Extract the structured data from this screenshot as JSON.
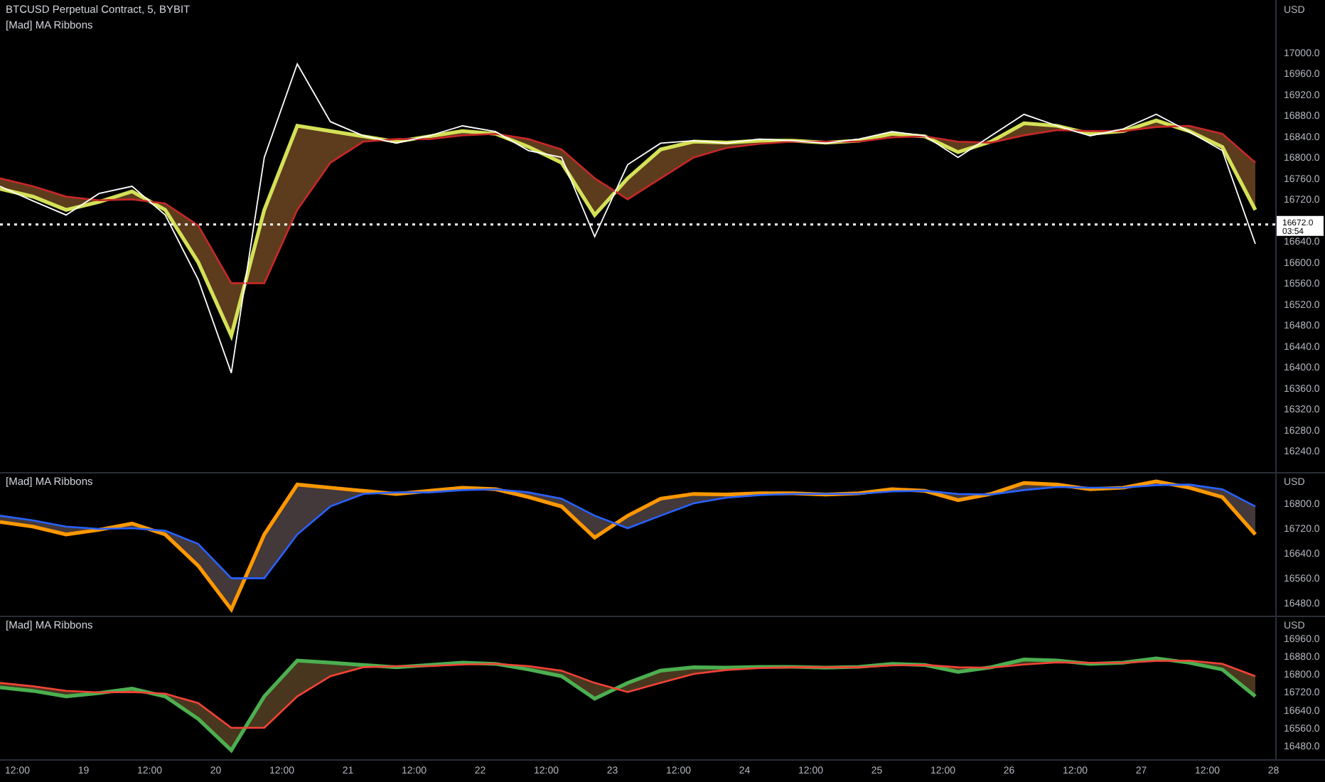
{
  "panes": [
    {
      "kind": "price",
      "legend": [
        "BTCUSD Perpetual Contract, 5, BYBIT",
        "[Mad] MA Ribbons"
      ],
      "axis_unit": "USD",
      "last_price": {
        "countdown": "03:54"
      },
      "chart_data": {
        "type": "line",
        "categories": [
          null,
          null,
          null,
          null,
          null,
          null,
          null,
          null,
          null,
          null,
          null,
          null,
          null,
          null,
          null,
          null,
          null,
          null,
          null,
          null,
          null,
          null,
          null,
          null,
          null,
          null,
          null,
          null,
          null,
          null,
          null,
          null,
          null,
          null,
          null,
          null,
          null,
          null,
          null
        ],
        "ylim": [
          16200,
          17100
        ],
        "yticks": [
          {
            "value": 17000,
            "label": "17000.0"
          },
          {
            "value": 16960,
            "label": "16960.0"
          },
          {
            "value": 16920,
            "label": "16920.0"
          },
          {
            "value": 16880,
            "label": "16880.0"
          },
          {
            "value": 16840,
            "label": "16840.0"
          },
          {
            "value": 16800,
            "label": "16800.0"
          },
          {
            "value": 16760,
            "label": "16760.0"
          },
          {
            "value": 16720,
            "label": "16720.0"
          },
          {
            "value": 16640,
            "label": "16640.0"
          },
          {
            "value": 16600,
            "label": "16600.0"
          },
          {
            "value": 16560,
            "label": "16560.0"
          },
          {
            "value": 16520,
            "label": "16520.0"
          },
          {
            "value": 16480,
            "label": "16480.0"
          },
          {
            "value": 16440,
            "label": "16440.0"
          },
          {
            "value": 16400,
            "label": "16400.0"
          },
          {
            "value": 16360,
            "label": "16360.0"
          },
          {
            "value": 16320,
            "label": "16320.0"
          },
          {
            "value": 16280,
            "label": "16280.0"
          },
          {
            "value": 16240,
            "label": "16240.0"
          }
        ],
        "series": [
          {
            "color": "#ffffff",
            "values": [
              16745,
              16717,
              16690,
              16731,
              16745,
              16690,
              16567,
              16389,
              16800,
              16978,
              16868,
              16841,
              16827,
              16841,
              16860,
              16849,
              16813,
              16800,
              16649,
              16786,
              16827,
              16832,
              16827,
              16835,
              16832,
              16827,
              16835,
              16849,
              16841,
              16800,
              16841,
              16882,
              16860,
              16841,
              16854,
              16882,
              16849,
              16813,
              16635
            ]
          },
          {
            "color": "#d4e157",
            "values": [
              16740,
              16725,
              16700,
              16715,
              16735,
              16700,
              16600,
              16460,
              16700,
              16860,
              16850,
              16840,
              16830,
              16840,
              16850,
              16845,
              16820,
              16790,
              16690,
              16760,
              16815,
              16830,
              16828,
              16832,
              16832,
              16828,
              16832,
              16845,
              16840,
              16810,
              16830,
              16865,
              16860,
              16845,
              16850,
              16870,
              16850,
              16820,
              16700
            ]
          },
          {
            "color": "#c62828",
            "values": [
              16760,
              16745,
              16725,
              16718,
              16720,
              16712,
              16670,
              16560,
              16560,
              16700,
              16790,
              16830,
              16835,
              16835,
              16842,
              16845,
              16835,
              16815,
              16760,
              16720,
              16760,
              16800,
              16818,
              16826,
              16830,
              16830,
              16830,
              16838,
              16840,
              16830,
              16828,
              16842,
              16852,
              16850,
              16850,
              16858,
              16860,
              16845,
              16790
            ]
          }
        ],
        "ref_lines": [
          {
            "axis": "y",
            "value": 16672,
            "label": "16672.0"
          }
        ]
      }
    },
    {
      "kind": "indicator",
      "legend": [
        "[Mad] MA Ribbons"
      ],
      "axis_unit": "USD",
      "chart_data": {
        "type": "line",
        "categories": [
          null,
          null,
          null,
          null,
          null,
          null,
          null,
          null,
          null,
          null,
          null,
          null,
          null,
          null,
          null,
          null,
          null,
          null,
          null,
          null,
          null,
          null,
          null,
          null,
          null,
          null,
          null,
          null,
          null,
          null,
          null,
          null,
          null,
          null,
          null,
          null,
          null,
          null,
          null
        ],
        "ylim": [
          16440,
          16900
        ],
        "yticks": [
          {
            "value": 16800,
            "label": "16800.0"
          },
          {
            "value": 16720,
            "label": "16720.0"
          },
          {
            "value": 16640,
            "label": "16640.0"
          },
          {
            "value": 16560,
            "label": "16560.0"
          },
          {
            "value": 16480,
            "label": "16480.0"
          }
        ],
        "series": [
          {
            "color": "#ff9800",
            "values": [
              16740,
              16725,
              16700,
              16715,
              16735,
              16700,
              16600,
              16460,
              16700,
              16860,
              16850,
              16840,
              16830,
              16840,
              16850,
              16845,
              16820,
              16790,
              16690,
              16760,
              16815,
              16830,
              16828,
              16832,
              16832,
              16828,
              16832,
              16845,
              16840,
              16810,
              16830,
              16865,
              16860,
              16845,
              16850,
              16870,
              16850,
              16820,
              16700
            ]
          },
          {
            "color": "#2962ff",
            "values": [
              16760,
              16745,
              16725,
              16718,
              16720,
              16712,
              16670,
              16560,
              16560,
              16700,
              16790,
              16830,
              16835,
              16835,
              16842,
              16845,
              16835,
              16815,
              16760,
              16720,
              16760,
              16800,
              16818,
              16826,
              16830,
              16830,
              16830,
              16838,
              16840,
              16830,
              16828,
              16842,
              16852,
              16850,
              16850,
              16858,
              16860,
              16845,
              16790
            ]
          }
        ]
      }
    },
    {
      "kind": "indicator",
      "legend": [
        "[Mad] MA Ribbons"
      ],
      "axis_unit": "USD",
      "chart_data": {
        "type": "line",
        "categories": [
          null,
          null,
          null,
          null,
          null,
          null,
          null,
          null,
          null,
          null,
          null,
          null,
          null,
          null,
          null,
          null,
          null,
          null,
          null,
          null,
          null,
          null,
          null,
          null,
          null,
          null,
          null,
          null,
          null,
          null,
          null,
          null,
          null,
          null,
          null,
          null,
          null,
          null,
          null
        ],
        "ylim": [
          16420,
          17060
        ],
        "yticks": [
          {
            "value": 16960,
            "label": "16960.0"
          },
          {
            "value": 16880,
            "label": "16880.0"
          },
          {
            "value": 16800,
            "label": "16800.0"
          },
          {
            "value": 16720,
            "label": "16720.0"
          },
          {
            "value": 16640,
            "label": "16640.0"
          },
          {
            "value": 16560,
            "label": "16560.0"
          },
          {
            "value": 16480,
            "label": "16480.0"
          }
        ],
        "series": [
          {
            "color": "#4caf50",
            "values": [
              16740,
              16725,
              16700,
              16715,
              16735,
              16700,
              16600,
              16460,
              16700,
              16860,
              16850,
              16840,
              16830,
              16840,
              16850,
              16845,
              16820,
              16790,
              16690,
              16760,
              16815,
              16830,
              16828,
              16832,
              16832,
              16828,
              16832,
              16845,
              16840,
              16810,
              16830,
              16865,
              16860,
              16845,
              16850,
              16870,
              16850,
              16820,
              16700
            ]
          },
          {
            "color": "#f44336",
            "values": [
              16760,
              16745,
              16725,
              16718,
              16720,
              16712,
              16670,
              16560,
              16560,
              16700,
              16790,
              16830,
              16835,
              16835,
              16842,
              16845,
              16835,
              16815,
              16760,
              16720,
              16760,
              16800,
              16818,
              16826,
              16830,
              16830,
              16830,
              16838,
              16840,
              16830,
              16828,
              16842,
              16852,
              16850,
              16850,
              16858,
              16860,
              16845,
              16790
            ]
          }
        ]
      }
    }
  ],
  "time_axis": [
    "12:00",
    "19",
    "12:00",
    "20",
    "12:00",
    "21",
    "12:00",
    "22",
    "12:00",
    "23",
    "12:00",
    "24",
    "12:00",
    "25",
    "12:00",
    "26",
    "12:00",
    "27",
    "12:00",
    "28"
  ]
}
